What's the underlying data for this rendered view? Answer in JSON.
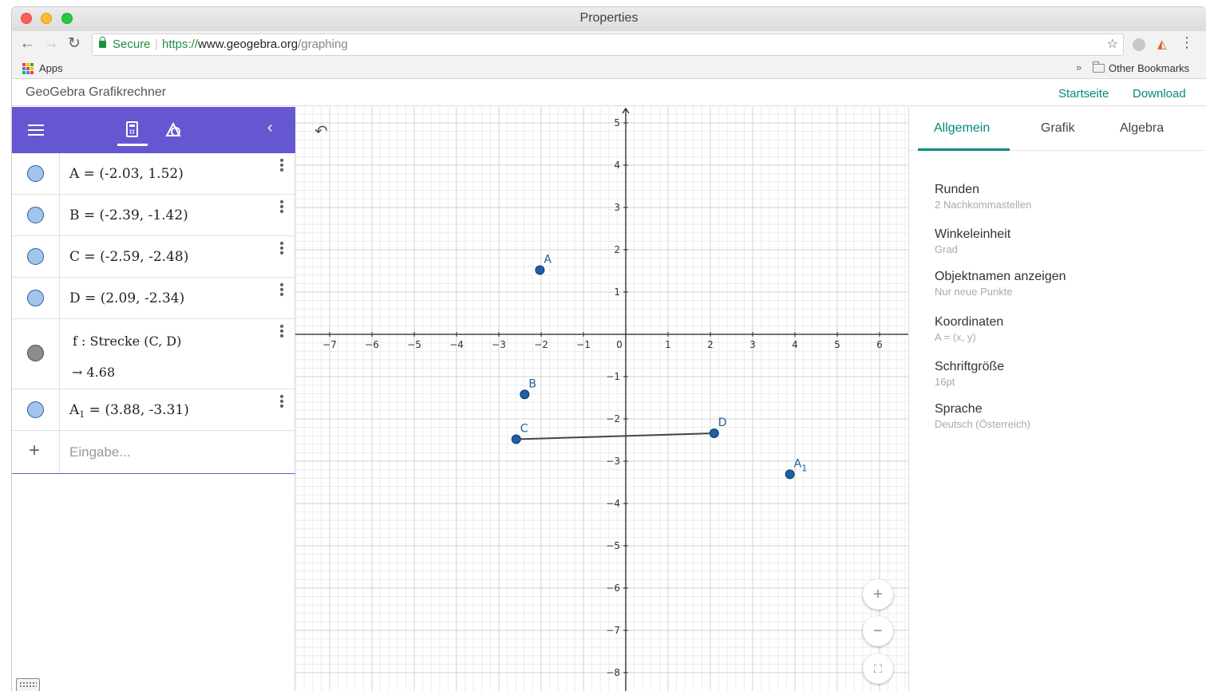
{
  "window": {
    "title": "Properties"
  },
  "browser": {
    "secure_label": "Secure",
    "url_scheme": "https://",
    "url_host": "www.geogebra.org",
    "url_path": "/graphing",
    "bookmarks": {
      "apps_label": "Apps",
      "more": "»",
      "other_label": "Other Bookmarks"
    }
  },
  "app": {
    "title": "GeoGebra Grafikrechner",
    "links": {
      "home": "Startseite",
      "download": "Download"
    }
  },
  "algebra": {
    "rows": [
      {
        "name": "A",
        "sub": "",
        "expr": " = (-2.03, 1.52)"
      },
      {
        "name": "B",
        "sub": "",
        "expr": " = (-2.39, -1.42)"
      },
      {
        "name": "C",
        "sub": "",
        "expr": " = (-2.59, -2.48)"
      },
      {
        "name": "D",
        "sub": "",
        "expr": " = (2.09, -2.34)"
      },
      {
        "name": "f",
        "sub": "",
        "expr": " : Strecke (C, D)",
        "value": "→  4.68"
      },
      {
        "name": "A",
        "sub": "1",
        "expr": " = (3.88, -3.31)"
      }
    ],
    "input_placeholder": "Eingabe..."
  },
  "graph": {
    "x_ticks": [
      "−7",
      "−6",
      "−5",
      "−4",
      "−3",
      "−2",
      "−1",
      "0",
      "1",
      "2",
      "3",
      "4",
      "5",
      "6"
    ],
    "y_ticks_pos": [
      "5",
      "4",
      "3",
      "2",
      "1"
    ],
    "y_ticks_neg": [
      "−1",
      "−2",
      "−3",
      "−4",
      "−5",
      "−6",
      "−7",
      "−8"
    ],
    "points": [
      {
        "label": "A",
        "x": -2.03,
        "y": 1.52
      },
      {
        "label": "B",
        "x": -2.39,
        "y": -1.42
      },
      {
        "label": "C",
        "x": -2.59,
        "y": -2.48
      },
      {
        "label": "D",
        "x": 2.09,
        "y": -2.34
      },
      {
        "label": "A",
        "sub": "1",
        "x": 3.88,
        "y": -3.31
      }
    ],
    "segment": {
      "from": "C",
      "to": "D"
    },
    "colors": {
      "point": "#1f5fa3",
      "label": "#1f5fa3",
      "segment": "#444444",
      "axis": "#222222",
      "major_grid": "#d2d2d2",
      "minor_grid": "#ececec"
    },
    "zoom": {
      "in": "+",
      "out": "−",
      "fit": "⛶"
    }
  },
  "properties": {
    "tabs": [
      "Allgemein",
      "Grafik",
      "Algebra"
    ],
    "items": [
      {
        "title": "Runden",
        "value": "2 Nachkommastellen"
      },
      {
        "title": "Winkeleinheit",
        "value": "Grad"
      },
      {
        "title": "Objektnamen anzeigen",
        "value": "Nur neue Punkte"
      },
      {
        "title": "Koordinaten",
        "value": "A = (x, y)"
      },
      {
        "title": "Schriftgröße",
        "value": "16pt"
      },
      {
        "title": "Sprache",
        "value": "Deutsch (Österreich)"
      }
    ]
  },
  "colors": {
    "accent_purple": "#6557d2",
    "accent_teal": "#00897b"
  }
}
